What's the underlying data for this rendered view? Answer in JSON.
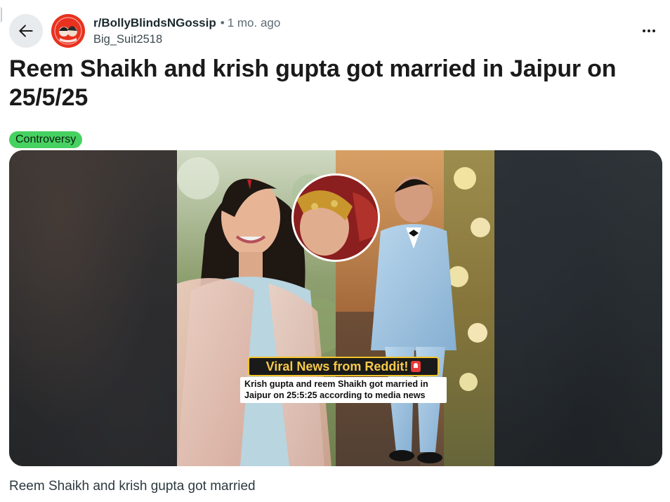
{
  "post": {
    "subreddit": "r/BollyBlindsNGossip",
    "separator": "•",
    "time": "1 mo. ago",
    "author": "Big_Suit2518",
    "title": "Reem Shaikh and krish gupta got married in Jaipur on 25/5/25",
    "flair": "Controversy",
    "flair_color": "#46d160",
    "caption": "Reem Shaikh and krish gupta got married"
  },
  "icons": {
    "back": "arrow-left-icon",
    "more": "more-horizontal-icon",
    "avatar": "subreddit-avatar"
  },
  "media": {
    "overlay_headline": "Viral News from Reddit!",
    "overlay_subtext": "Krish gupta and reem Shaikh got married in Jaipur on 25:5:25 according to media news"
  },
  "colors": {
    "back_button_bg": "#e8ebed",
    "avatar_bg": "#e8321f",
    "headline_text": "#f6c94a"
  }
}
